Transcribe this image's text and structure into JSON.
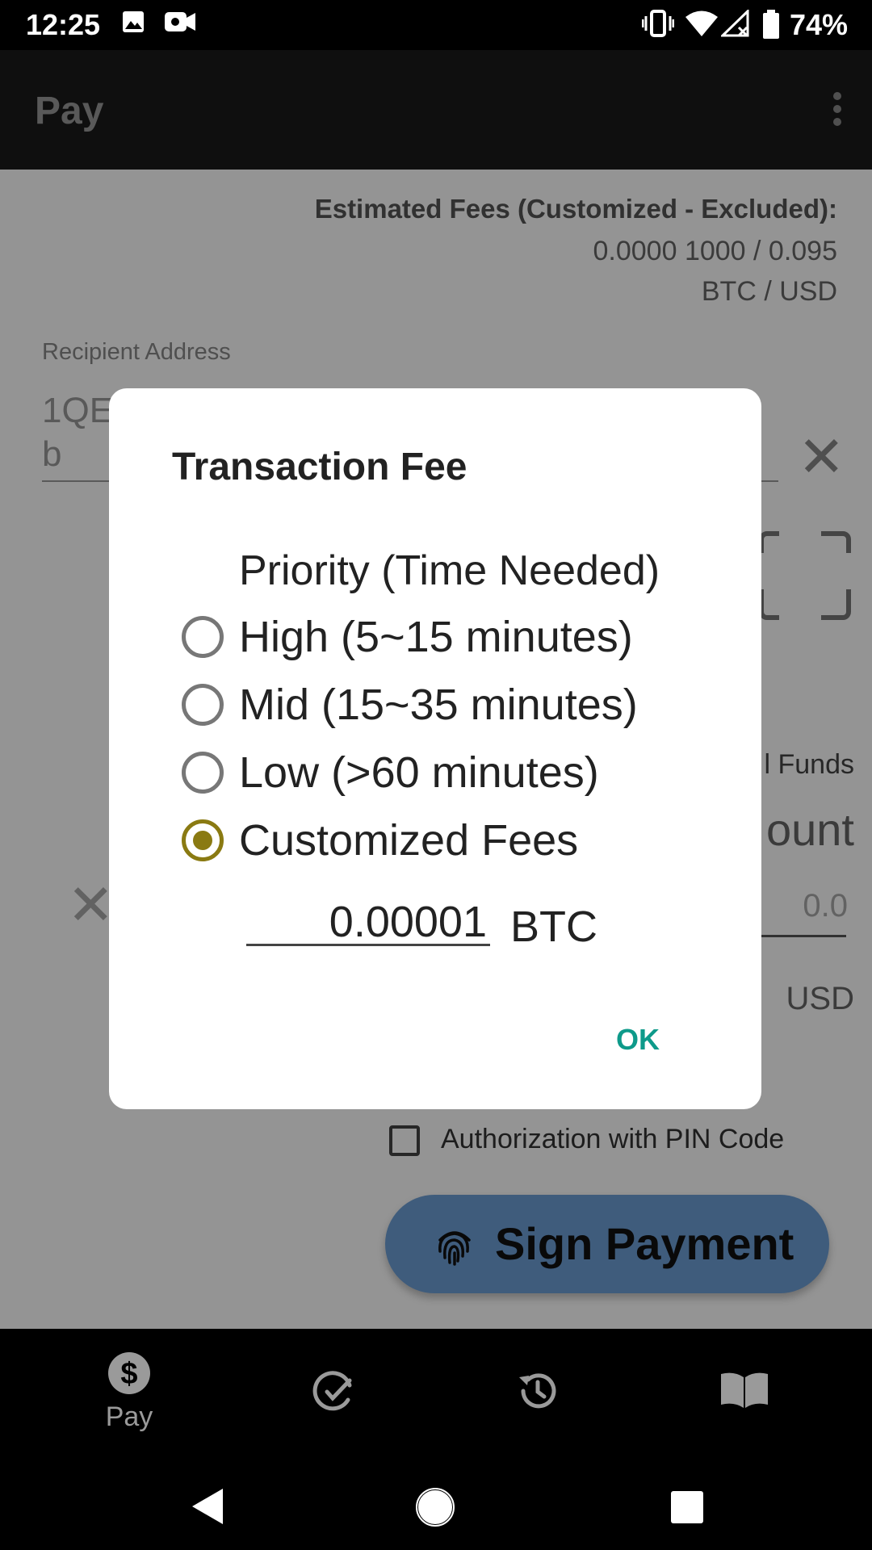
{
  "status_bar": {
    "time": "12:25",
    "battery": "74%"
  },
  "app_bar": {
    "title": "Pay"
  },
  "fees": {
    "label": "Estimated Fees (Customized - Excluded):",
    "value": "0.0000 1000 / 0.095",
    "unit": "BTC / USD"
  },
  "recipient": {
    "label": "Recipient Address",
    "value": "1QE                                                                      a\nb"
  },
  "amount": {
    "send_all_fragment": "l Funds",
    "label_fragment": "ount",
    "value": "0.0",
    "currency": "USD"
  },
  "authorization": {
    "label": "Authorization with PIN Code",
    "checked": false
  },
  "sign_button": {
    "label": "Sign Payment",
    "icon": "fingerprint-icon"
  },
  "bottom_nav": [
    {
      "label": "Pay",
      "icon": "dollar-icon"
    },
    {
      "label": "",
      "icon": "receive-icon"
    },
    {
      "label": "",
      "icon": "history-icon"
    },
    {
      "label": "",
      "icon": "book-icon"
    }
  ],
  "dialog": {
    "title": "Transaction Fee",
    "priority_header": "Priority (Time Needed)",
    "options": [
      {
        "label": "High (5~15 minutes)",
        "checked": false
      },
      {
        "label": "Mid (15~35 minutes)",
        "checked": false
      },
      {
        "label": "Low (>60 minutes)",
        "checked": false
      },
      {
        "label": "Customized Fees",
        "checked": true
      }
    ],
    "fee_value": "0.00001",
    "fee_unit": "BTC",
    "ok_label": "OK"
  },
  "colors": {
    "accent": "#0e9a8a",
    "radio_selected": "#8a7a12",
    "sign_button": "#6d9fd6"
  }
}
